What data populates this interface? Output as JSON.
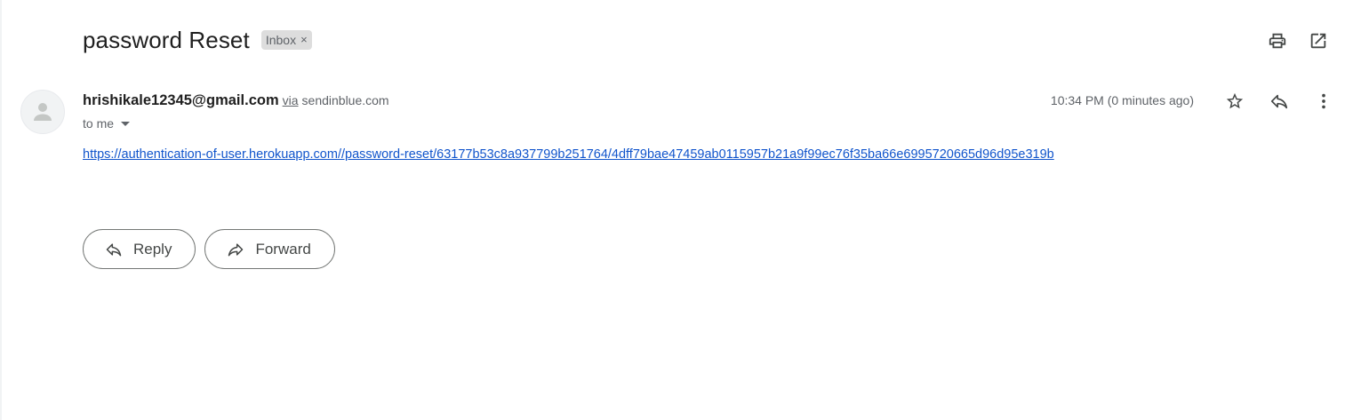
{
  "email": {
    "subject": "password Reset",
    "label": "Inbox",
    "label_remove": "×",
    "sender": "hrishikale12345@gmail.com",
    "via_text": "via",
    "via_domain": "sendinblue.com",
    "recipient": "to me",
    "timestamp": "10:34 PM (0 minutes ago)",
    "body_link": "https://authentication-of-user.herokuapp.com//password-reset/63177b53c8a937799b251764/4dff79bae47459ab0115957b21a9f99ec76f35ba66e6995720665d96d95e319b"
  },
  "actions": {
    "reply_label": "Reply",
    "forward_label": "Forward"
  },
  "icons": {
    "print": "print-icon",
    "open_new_window": "open-in-new-icon",
    "star": "star-icon",
    "reply": "reply-icon",
    "more": "more-vert-icon",
    "avatar": "person-icon"
  },
  "colors": {
    "link": "#1155cc",
    "chip_bg": "#dddddd",
    "button_border": "#747775"
  }
}
